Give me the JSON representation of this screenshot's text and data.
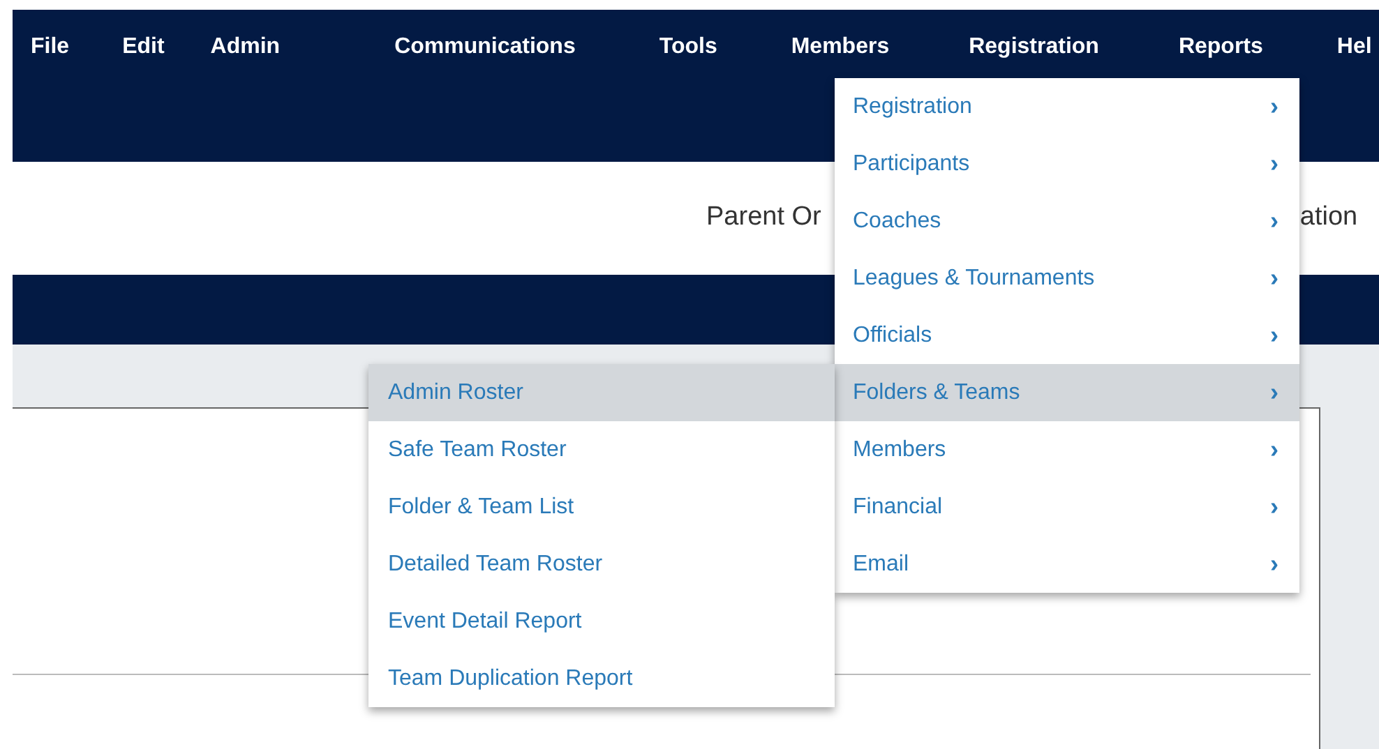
{
  "menu_bar": [
    "File",
    "Edit",
    "Admin",
    "Communications",
    "Tools",
    "Members",
    "Registration",
    "Reports",
    "Hel"
  ],
  "page_title": {
    "start": "Parent Or",
    "end": "ation"
  },
  "dropdown": [
    {
      "label": "Registration",
      "selected": false,
      "arrow": "›"
    },
    {
      "label": "Participants",
      "selected": false,
      "arrow": "›"
    },
    {
      "label": "Coaches",
      "selected": false,
      "arrow": "›"
    },
    {
      "label": "Leagues & Tournaments",
      "selected": false,
      "arrow": "›"
    },
    {
      "label": "Officials",
      "selected": false,
      "arrow": "›"
    },
    {
      "label": "Folders & Teams",
      "selected": true,
      "arrow": "›"
    },
    {
      "label": "Members",
      "selected": false,
      "arrow": "›"
    },
    {
      "label": "Financial",
      "selected": false,
      "arrow": "›"
    },
    {
      "label": "Email",
      "selected": false,
      "arrow": "›"
    }
  ],
  "submenu": [
    {
      "label": "Admin Roster",
      "selected": true
    },
    {
      "label": "Safe Team Roster",
      "selected": false
    },
    {
      "label": "Folder & Team List",
      "selected": false
    },
    {
      "label": "Detailed Team Roster",
      "selected": false
    },
    {
      "label": "Event Detail Report",
      "selected": false
    },
    {
      "label": "Team Duplication Report",
      "selected": false
    }
  ]
}
